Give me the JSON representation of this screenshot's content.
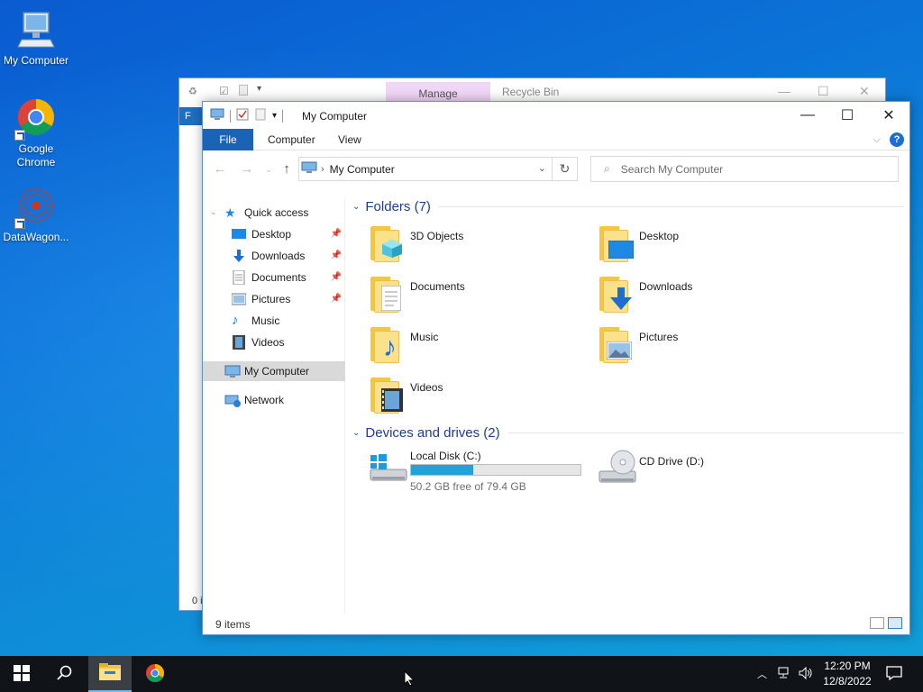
{
  "desktop": {
    "icons": [
      {
        "label": "My Computer",
        "icon": "monitor-icon"
      },
      {
        "label": "Google Chrome",
        "icon": "chrome-icon"
      },
      {
        "label": "DataWagon...",
        "icon": "datawagon-icon"
      }
    ]
  },
  "back_window": {
    "manage_tab": "Manage",
    "title": "Recycle Bin",
    "file_stub": "F",
    "status_stub": "0 i"
  },
  "window": {
    "title": "My Computer",
    "ribbon_tabs": [
      "File",
      "Computer",
      "View"
    ],
    "address": {
      "crumb": "My Computer"
    },
    "search": {
      "placeholder": "Search My Computer"
    },
    "sidebar": {
      "quick_access": "Quick access",
      "items": [
        {
          "label": "Desktop",
          "pinned": true,
          "icon": "desktop-folder-icon"
        },
        {
          "label": "Downloads",
          "pinned": true,
          "icon": "download-arrow-icon"
        },
        {
          "label": "Documents",
          "pinned": true,
          "icon": "document-icon"
        },
        {
          "label": "Pictures",
          "pinned": true,
          "icon": "pictures-icon"
        },
        {
          "label": "Music",
          "pinned": false,
          "icon": "music-note-icon"
        },
        {
          "label": "Videos",
          "pinned": false,
          "icon": "film-icon"
        }
      ],
      "my_computer": "My Computer",
      "network": "Network"
    },
    "folders_group": "Folders (7)",
    "folders": [
      {
        "label": "3D Objects",
        "icon": "3d-objects-folder-icon"
      },
      {
        "label": "Desktop",
        "icon": "desktop-folder-icon"
      },
      {
        "label": "Documents",
        "icon": "documents-folder-icon"
      },
      {
        "label": "Downloads",
        "icon": "downloads-folder-icon"
      },
      {
        "label": "Music",
        "icon": "music-folder-icon"
      },
      {
        "label": "Pictures",
        "icon": "pictures-folder-icon"
      },
      {
        "label": "Videos",
        "icon": "videos-folder-icon"
      }
    ],
    "drives_group": "Devices and drives (2)",
    "drives": [
      {
        "label": "Local Disk (C:)",
        "free": "50.2 GB free of 79.4 GB",
        "used_fraction": 0.368,
        "icon": "windows-drive-icon"
      },
      {
        "label": "CD Drive (D:)",
        "icon": "cd-drive-icon"
      }
    ],
    "status": "9 items"
  },
  "taskbar": {
    "time": "12:20 PM",
    "date": "12/8/2022"
  },
  "colors": {
    "accent": "#1a64b8",
    "drive_fill": "#26a0da",
    "folder": "#f3c93b",
    "group_header": "#1e3d8a"
  }
}
